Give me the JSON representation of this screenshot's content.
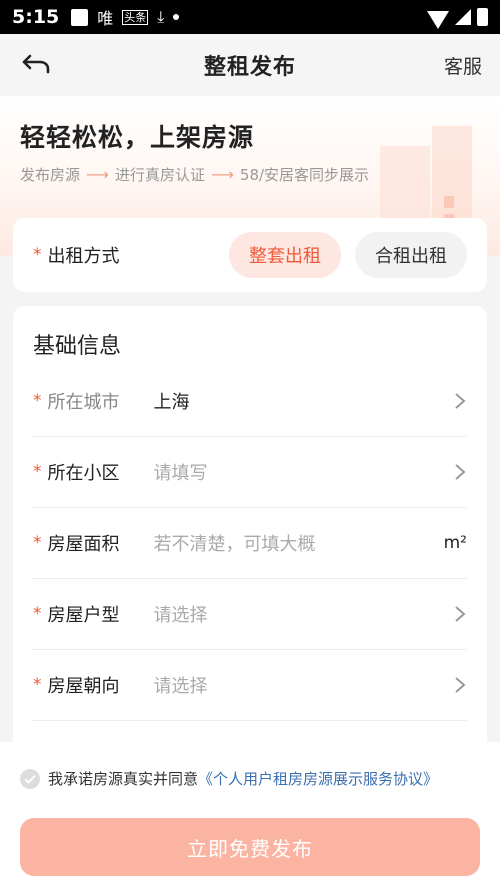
{
  "status_bar": {
    "time": "5:15",
    "app_label": "唯",
    "chip_label": "头条"
  },
  "header": {
    "title": "整租发布",
    "customer_service": "客服"
  },
  "hero": {
    "title": "轻轻松松，上架房源",
    "steps": [
      "发布房源",
      "进行真房认证",
      "58/安居客同步展示"
    ]
  },
  "rental_type": {
    "required_mark": "*",
    "label": "出租方式",
    "options": [
      {
        "label": "整套出租",
        "selected": true
      },
      {
        "label": "合租出租",
        "selected": false
      }
    ]
  },
  "basic_info": {
    "title": "基础信息",
    "fields": [
      {
        "label": "所在城市",
        "value": "上海",
        "placeholder": ""
      },
      {
        "label": "所在小区",
        "value": "",
        "placeholder": "请填写"
      },
      {
        "label": "房屋面积",
        "value": "",
        "placeholder": "若不清楚，可填大概",
        "unit": "m²"
      },
      {
        "label": "房屋户型",
        "value": "",
        "placeholder": "请选择"
      },
      {
        "label": "房屋朝向",
        "value": "",
        "placeholder": "请选择"
      }
    ]
  },
  "footer": {
    "agreement_text": "我承诺房源真实并同意",
    "agreement_link": "《个人用户租房房源展示服务协议》",
    "publish_button": "立即免费发布"
  },
  "colors": {
    "accent": "#f25a3c",
    "publish_button_bg": "#fbb3a2",
    "link": "#3a6fb0"
  }
}
